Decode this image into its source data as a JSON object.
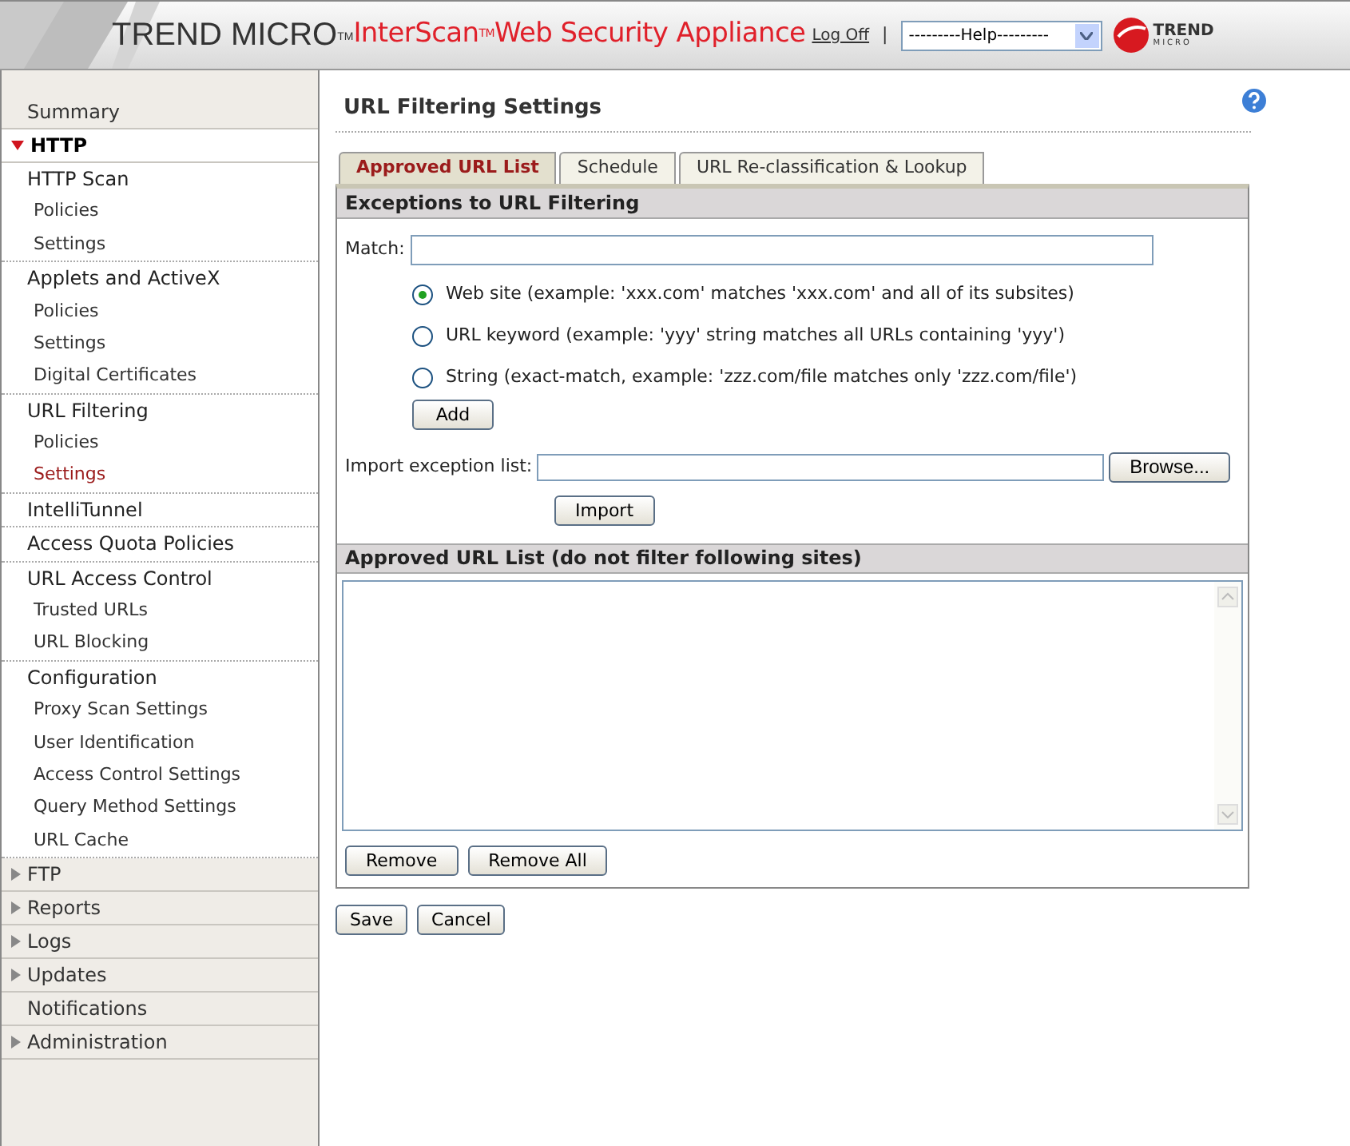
{
  "header": {
    "brand": "TREND MICRO$^{TM}$",
    "product": "InterScan$^{TM}$Web Security Appliance",
    "logoff": "Log Off",
    "separator": "|",
    "help_select": "---------Help---------",
    "logo_text": "TREND",
    "logo_subtext": "MICRO"
  },
  "nav": [
    {
      "kind": "link",
      "label": "Summary"
    },
    {
      "kind": "section",
      "label": "HTTP",
      "expanded": true,
      "children": [
        {
          "label": "HTTP Scan",
          "selected": false,
          "children": [
            {
              "label": "Policies",
              "selected": false
            },
            {
              "label": "Settings",
              "selected": false
            }
          ]
        },
        {
          "label": "Applets and ActiveX",
          "selected": false,
          "children": [
            {
              "label": "Policies",
              "selected": false
            },
            {
              "label": "Settings",
              "selected": false
            },
            {
              "label": "Digital Certificates",
              "selected": false
            }
          ]
        },
        {
          "label": "URL Filtering",
          "selected": false,
          "children": [
            {
              "label": "Policies",
              "selected": false
            },
            {
              "label": "Settings",
              "selected": true
            }
          ]
        },
        {
          "label": "IntelliTunnel",
          "selected": false
        },
        {
          "label": "Access Quota Policies",
          "selected": false
        },
        {
          "label": "URL Access Control",
          "selected": false,
          "children": [
            {
              "label": "Trusted URLs",
              "selected": false
            },
            {
              "label": "URL Blocking",
              "selected": false
            }
          ]
        },
        {
          "label": "Configuration",
          "selected": false,
          "children": [
            {
              "label": "Proxy Scan Settings",
              "selected": false
            },
            {
              "label": "User Identification",
              "selected": false
            },
            {
              "label": "Access Control Settings",
              "selected": false
            },
            {
              "label": "Query Method Settings",
              "selected": false
            },
            {
              "label": "URL Cache",
              "selected": false
            }
          ]
        }
      ]
    },
    {
      "kind": "section",
      "label": "FTP",
      "expanded": false
    },
    {
      "kind": "section",
      "label": "Reports",
      "expanded": false
    },
    {
      "kind": "section",
      "label": "Logs",
      "expanded": false
    },
    {
      "kind": "section",
      "label": "Updates",
      "expanded": false
    },
    {
      "kind": "link",
      "label": "Notifications"
    },
    {
      "kind": "section",
      "label": "Administration",
      "expanded": false
    }
  ],
  "page": {
    "title": "URL Filtering Settings",
    "tabs": [
      {
        "label": "Approved URL List",
        "selected": true
      },
      {
        "label": "Schedule",
        "selected": false
      },
      {
        "label": "URL Re-classification & Lookup",
        "selected": false
      }
    ],
    "exceptions": {
      "heading": "Exceptions to URL Filtering",
      "match_label": "Match:",
      "options": [
        {
          "label": "Web site (example: 'xxx.com' matches 'xxx.com' and all of its subsites)",
          "selected": true
        },
        {
          "label": "URL keyword (example: 'yyy' string matches all URLs containing 'yyy')",
          "selected": false
        },
        {
          "label": "String (exact-match, example: 'zzz.com/file matches only 'zzz.com/file')",
          "selected": false
        }
      ],
      "add_button": "Add",
      "import_label": "Import exception list:",
      "browse_button": "Browse...",
      "import_button": "Import"
    },
    "approved": {
      "heading": "Approved URL List (do not filter following sites)",
      "remove_button": "Remove",
      "remove_all_button": "Remove All"
    },
    "buttons": [
      "Save",
      "Cancel"
    ]
  }
}
